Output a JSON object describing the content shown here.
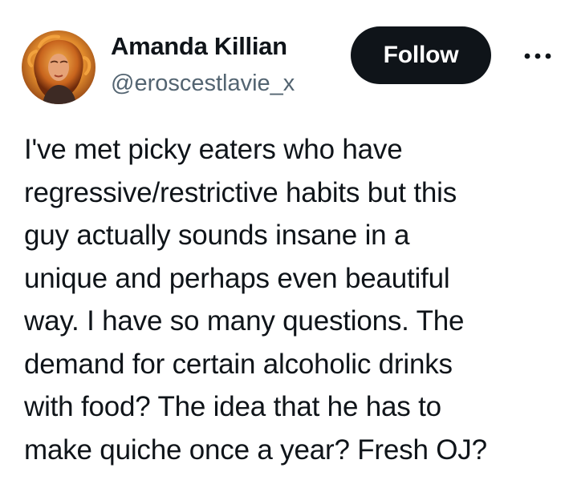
{
  "author": {
    "display_name": "Amanda Killian",
    "handle": "@eroscestlavie_x",
    "avatar_icon": "profile-photo"
  },
  "actions": {
    "follow_label": "Follow",
    "more_icon": "more-horizontal-icon"
  },
  "tweet": {
    "lines": [
      "I've met picky eaters who have",
      "regressive/restrictive habits but this",
      "guy actually sounds insane in a",
      "unique and perhaps even beautiful",
      "way. I have so many questions. The",
      "demand for certain alcoholic drinks",
      "with food? The idea that he has to",
      "make quiche once a year? Fresh OJ?"
    ]
  },
  "colors": {
    "text": "#0f1419",
    "secondary": "#536471",
    "button_bg": "#0f1419",
    "button_text": "#ffffff",
    "background": "#ffffff"
  }
}
